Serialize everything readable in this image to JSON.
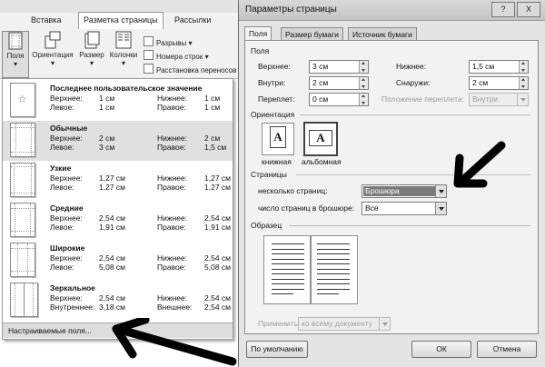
{
  "ribbon": {
    "tabs": [
      "Вставка",
      "Разметка страницы",
      "Рассылки"
    ],
    "active_tab": "Разметка страницы",
    "buttons": {
      "margins": "Поля",
      "orientation": "Ориентация",
      "size": "Размер",
      "columns": "Колонки"
    },
    "small": {
      "breaks": "Разрывы",
      "line_numbers": "Номера строк",
      "hyphenation": "Расстановка переносов"
    }
  },
  "margins_menu": {
    "presets": [
      {
        "name": "Последнее пользовательское значение",
        "r1l": "Верхнее:",
        "r1v": "1 см",
        "r1l2": "Нижнее:",
        "r1v2": "1 см",
        "r2l": "Левое:",
        "r2v": "1 см",
        "r2l2": "Правое:",
        "r2v2": "1 см"
      },
      {
        "name": "Обычные",
        "r1l": "Верхнее:",
        "r1v": "2 см",
        "r1l2": "Нижнее:",
        "r1v2": "2 см",
        "r2l": "Левое:",
        "r2v": "3 см",
        "r2l2": "Правое:",
        "r2v2": "1,5 см"
      },
      {
        "name": "Узкие",
        "r1l": "Верхнее:",
        "r1v": "1,27 см",
        "r1l2": "Нижнее:",
        "r1v2": "1,27 см",
        "r2l": "Левое:",
        "r2v": "1,27 см",
        "r2l2": "Правое:",
        "r2v2": "1,27 см"
      },
      {
        "name": "Средние",
        "r1l": "Верхнее:",
        "r1v": "2,54 см",
        "r1l2": "Нижнее:",
        "r1v2": "2,54 см",
        "r2l": "Левое:",
        "r2v": "1,91 см",
        "r2l2": "Правое:",
        "r2v2": "1,91 см"
      },
      {
        "name": "Широкие",
        "r1l": "Верхнее:",
        "r1v": "2,54 см",
        "r1l2": "Нижнее:",
        "r1v2": "2,54 см",
        "r2l": "Левое:",
        "r2v": "5,08 см",
        "r2l2": "Правое:",
        "r2v2": "5,08 см"
      },
      {
        "name": "Зеркальное",
        "r1l": "Верхнее:",
        "r1v": "2,54 см",
        "r1l2": "Нижнее:",
        "r1v2": "2,54 см",
        "r2l": "Внутреннее:",
        "r2v": "3,18 см",
        "r2l2": "Внешнее:",
        "r2v2": "2,54 см"
      }
    ],
    "custom": "Настраиваемые поля..."
  },
  "dialog": {
    "title": "Параметры страницы",
    "help": "?",
    "close": "X",
    "tabs": [
      "Поля",
      "Размер бумаги",
      "Источник бумаги"
    ],
    "fields_section": "Поля",
    "top_label": "Верхнее:",
    "top_value": "3 см",
    "bottom_label": "Нижнее:",
    "bottom_value": "1,5 см",
    "inside_label": "Внутри:",
    "inside_value": "2 см",
    "outside_label": "Снаружи:",
    "outside_value": "2 см",
    "gutter_label": "Переплет:",
    "gutter_value": "0 см",
    "gutter_pos_label": "Положение переплета:",
    "gutter_pos_value": "Внутри",
    "orientation_section": "Ориентация",
    "portrait": "книжная",
    "landscape": "альбомная",
    "pages_section": "Страницы",
    "multiple_pages_label": "несколько страниц:",
    "multiple_pages_value": "Брошюра",
    "sheets_label": "число страниц в брошюре:",
    "sheets_value": "Все",
    "preview_section": "Образец",
    "apply_label": "Применить:",
    "apply_value": "ко всему документу",
    "default_btn": "По умолчанию",
    "ok_btn": "ОК",
    "cancel_btn": "Отмена"
  }
}
